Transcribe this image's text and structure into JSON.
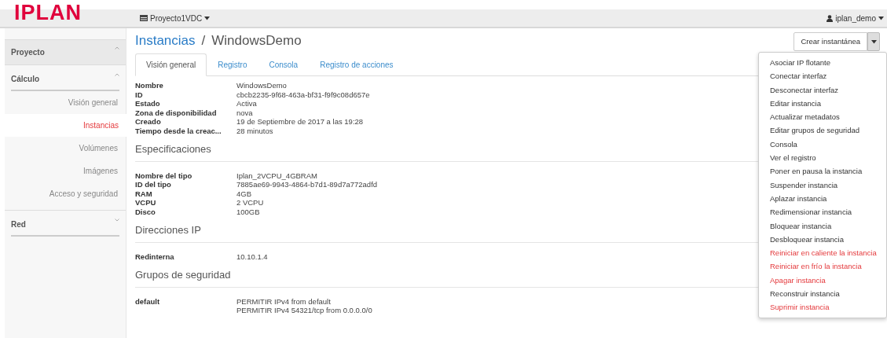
{
  "brand": "IPLAN",
  "navbar": {
    "project": "Proyecto1VDC",
    "user": "iplan_demo"
  },
  "sidebar": {
    "sections": [
      {
        "label": "Proyecto",
        "expanded": true,
        "kind": "top"
      },
      {
        "label": "Cálculo",
        "expanded": true,
        "kind": "group",
        "items": [
          {
            "label": "Visión general",
            "selected": false
          },
          {
            "label": "Instancias",
            "selected": true
          },
          {
            "label": "Volúmenes",
            "selected": false
          },
          {
            "label": "Imágenes",
            "selected": false
          },
          {
            "label": "Acceso y seguridad",
            "selected": false
          }
        ]
      },
      {
        "label": "Red",
        "expanded": false,
        "kind": "group"
      }
    ]
  },
  "breadcrumb": {
    "parent": "Instancias",
    "separator": "/",
    "current": "WindowsDemo"
  },
  "actions": {
    "button": "Crear instantánea",
    "menu": [
      {
        "label": "Asociar IP flotante",
        "danger": false
      },
      {
        "label": "Conectar interfaz",
        "danger": false
      },
      {
        "label": "Desconectar interfaz",
        "danger": false
      },
      {
        "label": "Editar instancia",
        "danger": false
      },
      {
        "label": "Actualizar metadatos",
        "danger": false
      },
      {
        "label": "Editar grupos de seguridad",
        "danger": false
      },
      {
        "label": "Consola",
        "danger": false
      },
      {
        "label": "Ver el registro",
        "danger": false
      },
      {
        "label": "Poner en pausa la instancia",
        "danger": false
      },
      {
        "label": "Suspender instancia",
        "danger": false
      },
      {
        "label": "Aplazar instancia",
        "danger": false
      },
      {
        "label": "Redimensionar instancia",
        "danger": false
      },
      {
        "label": "Bloquear instancia",
        "danger": false
      },
      {
        "label": "Desbloquear instancia",
        "danger": false
      },
      {
        "label": "Reiniciar en caliente la instancia",
        "danger": true
      },
      {
        "label": "Reiniciar en frío la instancia",
        "danger": true
      },
      {
        "label": "Apagar instancia",
        "danger": true
      },
      {
        "label": "Reconstruir instancia",
        "danger": false
      },
      {
        "label": "Suprimir instancia",
        "danger": true
      }
    ]
  },
  "tabs": [
    {
      "label": "Visión general",
      "selected": true
    },
    {
      "label": "Registro",
      "selected": false
    },
    {
      "label": "Consola",
      "selected": false
    },
    {
      "label": "Registro de acciones",
      "selected": false
    }
  ],
  "sections": [
    {
      "rows": [
        {
          "label": "Nombre",
          "value": "WindowsDemo"
        },
        {
          "label": "ID",
          "value": "cbcb2235-9f68-463a-bf31-f9f9c08d657e"
        },
        {
          "label": "Estado",
          "value": "Activa"
        },
        {
          "label": "Zona de disponibilidad",
          "value": "nova"
        },
        {
          "label": "Creado",
          "value": "19 de Septiembre de 2017 a las 19:28"
        },
        {
          "label": "Tiempo desde la creac...",
          "value": "28 minutos"
        }
      ]
    },
    {
      "title": "Especificaciones",
      "rows": [
        {
          "label": "Nombre del tipo",
          "value": "Iplan_2VCPU_4GBRAM"
        },
        {
          "label": "ID del tipo",
          "value": "7885ae69-9943-4864-b7d1-89d7a772adfd"
        },
        {
          "label": "RAM",
          "value": "4GB"
        },
        {
          "label": "VCPU",
          "value": "2 VCPU"
        },
        {
          "label": "Disco",
          "value": "100GB"
        }
      ]
    },
    {
      "title": "Direcciones IP",
      "rows": [
        {
          "label": "Redinterna",
          "value": "10.10.1.4"
        }
      ]
    },
    {
      "title": "Grupos de seguridad",
      "rows": [
        {
          "label": "default",
          "values": [
            "PERMITIR IPv4 from default",
            "PERMITIR IPv4 54321/tcp from 0.0.0.0/0"
          ]
        }
      ]
    }
  ]
}
